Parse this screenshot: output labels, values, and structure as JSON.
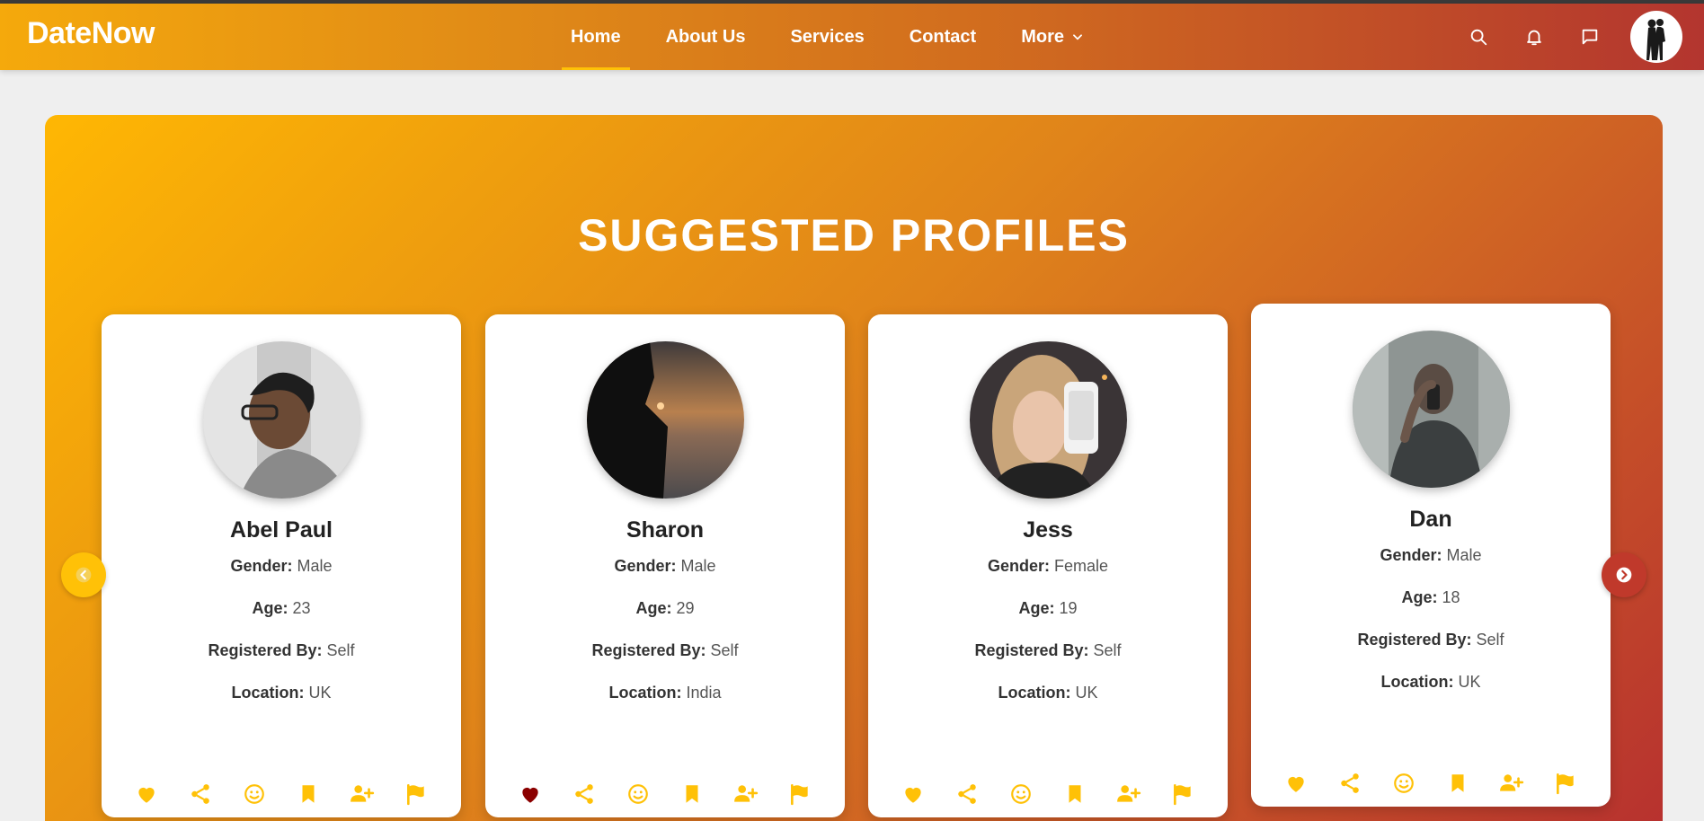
{
  "brand": "DateNow",
  "nav": {
    "links": [
      {
        "label": "Home",
        "active": true
      },
      {
        "label": "About Us"
      },
      {
        "label": "Services"
      },
      {
        "label": "Contact"
      },
      {
        "label": "More"
      }
    ]
  },
  "colors": {
    "accent": "#ffc107",
    "liked": "#8b0000",
    "gradient_start": "#ffb703",
    "gradient_end": "#b3352f"
  },
  "icons": {
    "header": [
      "search-icon",
      "bell-icon",
      "chat-icon",
      "user-avatar"
    ],
    "card_actions": [
      "heart-icon",
      "share-icon",
      "smile-icon",
      "bookmark-icon",
      "add-user-icon",
      "flag-icon"
    ]
  },
  "section": {
    "title": "SUGGESTED PROFILES"
  },
  "labels": {
    "gender": "Gender:",
    "age": "Age:",
    "registered_by": "Registered By:",
    "location": "Location:"
  },
  "profiles": [
    {
      "name": "Abel Paul",
      "gender": "Male",
      "age": "23",
      "registered_by": "Self",
      "location": "UK",
      "liked": false
    },
    {
      "name": "Sharon",
      "gender": "Male",
      "age": "29",
      "registered_by": "Self",
      "location": "India",
      "liked": true
    },
    {
      "name": "Jess",
      "gender": "Female",
      "age": "19",
      "registered_by": "Self",
      "location": "UK",
      "liked": false
    },
    {
      "name": "Dan",
      "gender": "Male",
      "age": "18",
      "registered_by": "Self",
      "location": "UK",
      "liked": false
    }
  ]
}
